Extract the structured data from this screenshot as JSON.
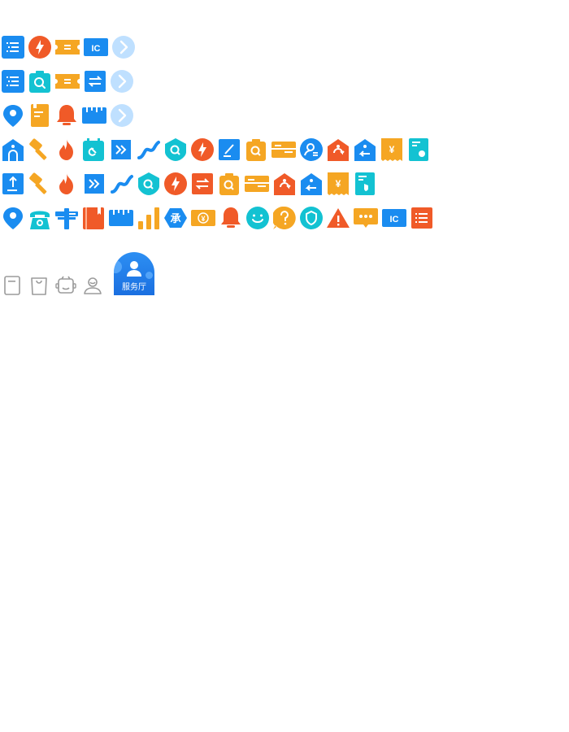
{
  "colors": {
    "blue": "#1a8cf0",
    "orange": "#f05a28",
    "amber": "#f5a623",
    "teal": "#13c2d2",
    "light_blue": "#bfe0ff",
    "gray_outline": "#9b9b9b"
  },
  "rows": [
    {
      "id": "row1",
      "icons": [
        "list-icon",
        "lightning-icon",
        "ticket-icon",
        "ic-card-icon",
        "chevron-right-icon"
      ]
    },
    {
      "id": "row2",
      "icons": [
        "list-icon",
        "bag-search-icon",
        "ticket-icon",
        "transfer-icon",
        "chevron-right-icon"
      ]
    },
    {
      "id": "row3",
      "icons": [
        "location-pin-icon",
        "document-icon",
        "bell-icon",
        "ruler-icon",
        "chevron-right-icon"
      ]
    },
    {
      "id": "row4",
      "icons": [
        "home-tag-icon",
        "hammer-icon",
        "flame-icon",
        "calendar-icon",
        "forward-icon",
        "cable-icon",
        "shield-search-icon",
        "lightning-icon",
        "edit-icon",
        "bag-search-icon",
        "card-icon",
        "user-settings-icon",
        "tag-return-icon",
        "tag-back-icon",
        "receipt-yuan-icon",
        "bill-icon"
      ]
    },
    {
      "id": "row5",
      "icons": [
        "upload-tag-icon",
        "hammer-icon",
        "flame-icon",
        "forward-icon",
        "cable-icon",
        "shield-search-icon",
        "lightning-icon",
        "transfer-icon",
        "bag-search-icon",
        "card-icon",
        "tag-return-icon",
        "tag-back-icon",
        "receipt-yuan-icon",
        "bill-icon"
      ]
    },
    {
      "id": "row6",
      "icons": [
        "location-pin-icon",
        "phone-icon",
        "pole-icon",
        "book-icon",
        "ruler-icon",
        "bar-chart-icon",
        "hexagon-cheng-icon",
        "money-icon",
        "bell-icon",
        "smile-icon",
        "help-icon",
        "shield-check-icon",
        "warning-icon",
        "chat-icon",
        "ic-card-icon",
        "list-icon"
      ]
    }
  ],
  "tabbar": {
    "icons": [
      "tab-document-icon",
      "tab-bag-icon",
      "tab-robot-icon",
      "tab-user-icon"
    ],
    "service_hall_label": "服务厅"
  },
  "text": {
    "ic": "IC",
    "cheng": "承",
    "yuan": "¥"
  }
}
